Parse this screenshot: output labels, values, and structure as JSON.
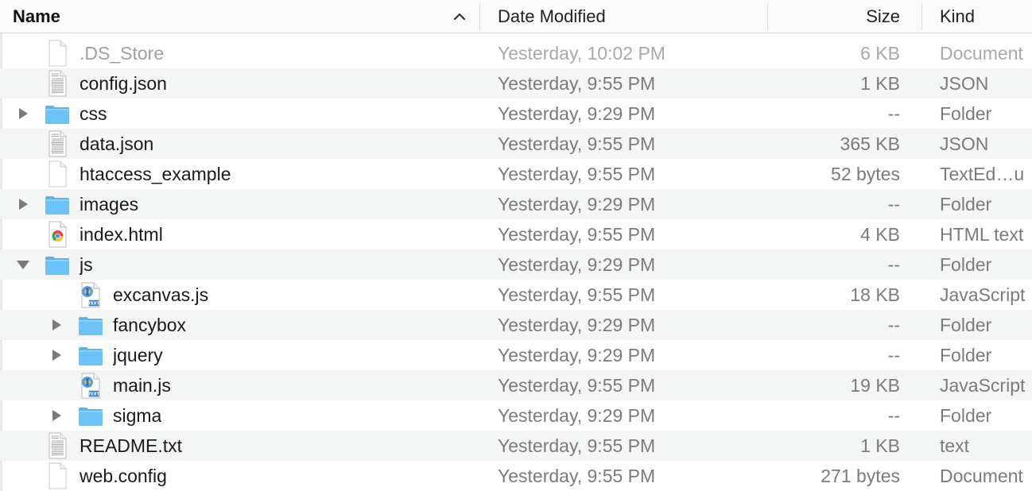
{
  "columns": {
    "name": "Name",
    "date_modified": "Date Modified",
    "size": "Size",
    "kind": "Kind"
  },
  "rows": [
    {
      "name": ".DS_Store",
      "date": "Yesterday, 10:02 PM",
      "size": "6 KB",
      "kind": "Document",
      "icon": "blank-document-icon",
      "level": 0,
      "disclosure": "none",
      "dim": true
    },
    {
      "name": "config.json",
      "date": "Yesterday, 9:55 PM",
      "size": "1 KB",
      "kind": "JSON",
      "icon": "text-document-icon",
      "level": 0,
      "disclosure": "none"
    },
    {
      "name": "css",
      "date": "Yesterday, 9:29 PM",
      "size": "--",
      "kind": "Folder",
      "icon": "folder-icon",
      "level": 0,
      "disclosure": "collapsed"
    },
    {
      "name": "data.json",
      "date": "Yesterday, 9:55 PM",
      "size": "365 KB",
      "kind": "JSON",
      "icon": "text-document-icon",
      "level": 0,
      "disclosure": "none"
    },
    {
      "name": "htaccess_example",
      "date": "Yesterday, 9:55 PM",
      "size": "52 bytes",
      "kind": "TextEd…u",
      "icon": "blank-document-icon",
      "level": 0,
      "disclosure": "none"
    },
    {
      "name": "images",
      "date": "Yesterday, 9:29 PM",
      "size": "--",
      "kind": "Folder",
      "icon": "folder-icon",
      "level": 0,
      "disclosure": "collapsed"
    },
    {
      "name": "index.html",
      "date": "Yesterday, 9:55 PM",
      "size": "4 KB",
      "kind": "HTML text",
      "icon": "html-document-icon",
      "level": 0,
      "disclosure": "none"
    },
    {
      "name": "js",
      "date": "Yesterday, 9:29 PM",
      "size": "--",
      "kind": "Folder",
      "icon": "folder-icon",
      "level": 0,
      "disclosure": "expanded"
    },
    {
      "name": "excanvas.js",
      "date": "Yesterday, 9:55 PM",
      "size": "18 KB",
      "kind": "JavaScript",
      "icon": "javascript-document-icon",
      "level": 1,
      "disclosure": "none"
    },
    {
      "name": "fancybox",
      "date": "Yesterday, 9:29 PM",
      "size": "--",
      "kind": "Folder",
      "icon": "folder-icon",
      "level": 1,
      "disclosure": "collapsed"
    },
    {
      "name": "jquery",
      "date": "Yesterday, 9:29 PM",
      "size": "--",
      "kind": "Folder",
      "icon": "folder-icon",
      "level": 1,
      "disclosure": "collapsed"
    },
    {
      "name": "main.js",
      "date": "Yesterday, 9:55 PM",
      "size": "19 KB",
      "kind": "JavaScript",
      "icon": "javascript-document-icon",
      "level": 1,
      "disclosure": "none"
    },
    {
      "name": "sigma",
      "date": "Yesterday, 9:29 PM",
      "size": "--",
      "kind": "Folder",
      "icon": "folder-icon",
      "level": 1,
      "disclosure": "collapsed"
    },
    {
      "name": "README.txt",
      "date": "Yesterday, 9:55 PM",
      "size": "1 KB",
      "kind": "text",
      "icon": "text-document-icon",
      "level": 0,
      "disclosure": "none"
    },
    {
      "name": "web.config",
      "date": "Yesterday, 9:55 PM",
      "size": "271 bytes",
      "kind": "Document",
      "icon": "blank-document-icon",
      "level": 0,
      "disclosure": "none"
    }
  ],
  "colors": {
    "folder": "#6cc3f7",
    "folder_tab": "#5ab2ea",
    "disclosure": "#7a7a7a",
    "alt_row": "#f4f5f5"
  }
}
